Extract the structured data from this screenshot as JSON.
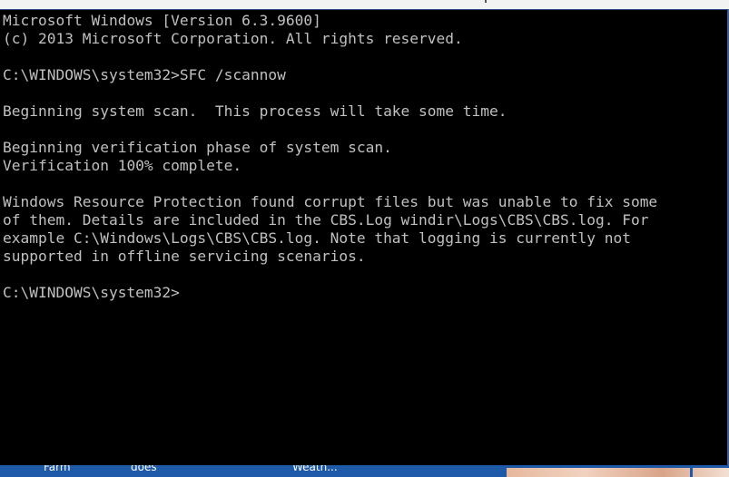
{
  "console": {
    "lines": [
      "Microsoft Windows [Version 6.3.9600]",
      "(c) 2013 Microsoft Corporation. All rights reserved.",
      "",
      "C:\\WINDOWS\\system32>SFC /scannow",
      "",
      "Beginning system scan.  This process will take some time.",
      "",
      "Beginning verification phase of system scan.",
      "Verification 100% complete.",
      "",
      "Windows Resource Protection found corrupt files but was unable to fix some",
      "of them. Details are included in the CBS.Log windir\\Logs\\CBS\\CBS.log. For",
      "example C:\\Windows\\Logs\\CBS\\CBS.log. Note that logging is currently not",
      "supported in offline servicing scenarios.",
      "",
      "C:\\WINDOWS\\system32>"
    ],
    "text_color": "#c0c0c0",
    "background_color": "#000000"
  },
  "taskbar": {
    "labels": [
      "Farm",
      "does",
      "Weath..."
    ],
    "color": "#1e5aa8"
  }
}
